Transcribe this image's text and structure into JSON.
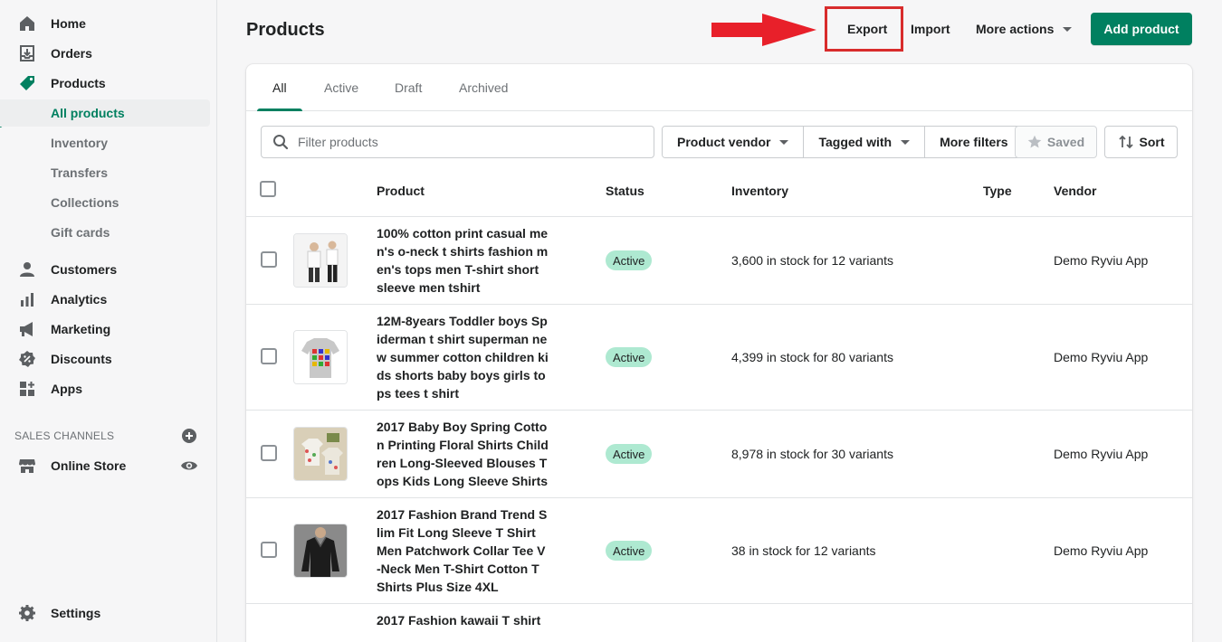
{
  "sidebar": {
    "home": "Home",
    "orders": "Orders",
    "products": "Products",
    "sub": {
      "all_products": "All products",
      "inventory": "Inventory",
      "transfers": "Transfers",
      "collections": "Collections",
      "gift_cards": "Gift cards"
    },
    "customers": "Customers",
    "analytics": "Analytics",
    "marketing": "Marketing",
    "discounts": "Discounts",
    "apps": "Apps",
    "sales_channels_title": "SALES CHANNELS",
    "online_store": "Online Store",
    "settings": "Settings"
  },
  "header": {
    "title": "Products",
    "export": "Export",
    "import": "Import",
    "more_actions": "More actions",
    "add_product": "Add product"
  },
  "tabs": [
    "All",
    "Active",
    "Draft",
    "Archived"
  ],
  "filters": {
    "search_placeholder": "Filter products",
    "product_vendor": "Product vendor",
    "tagged_with": "Tagged with",
    "more_filters": "More filters",
    "saved": "Saved",
    "sort": "Sort"
  },
  "table": {
    "columns": [
      "Product",
      "Status",
      "Inventory",
      "Type",
      "Vendor"
    ],
    "rows": [
      {
        "name": "100% cotton print casual men's o-neck t shirts fashion men's tops men T-shirt short sleeve men tshirt",
        "status": "Active",
        "inventory": "3,600 in stock for 12 variants",
        "type": "",
        "vendor": "Demo Ryviu App"
      },
      {
        "name": "12M-8years Toddler boys Spiderman t shirt superman new summer cotton children kids shorts baby boys girls tops tees t shirt",
        "status": "Active",
        "inventory": "4,399 in stock for 80 variants",
        "type": "",
        "vendor": "Demo Ryviu App"
      },
      {
        "name": "2017 Baby Boy Spring Cotton Printing Floral Shirts Children Long-Sleeved Blouses Tops Kids Long Sleeve Shirts",
        "status": "Active",
        "inventory": "8,978 in stock for 30 variants",
        "type": "",
        "vendor": "Demo Ryviu App"
      },
      {
        "name": "2017 Fashion Brand Trend Slim Fit Long Sleeve T Shirt Men Patchwork Collar Tee V-Neck Men T-Shirt Cotton T Shirts Plus Size 4XL",
        "status": "Active",
        "inventory": "38 in stock for 12 variants",
        "type": "",
        "vendor": "Demo Ryviu App"
      },
      {
        "name": "2017 Fashion kawaii T shirt",
        "status": "",
        "inventory": "",
        "type": "",
        "vendor": ""
      }
    ]
  },
  "colors": {
    "accent": "#008060",
    "badge_active": "#aee9d1",
    "highlight_red": "#d82c2c"
  }
}
